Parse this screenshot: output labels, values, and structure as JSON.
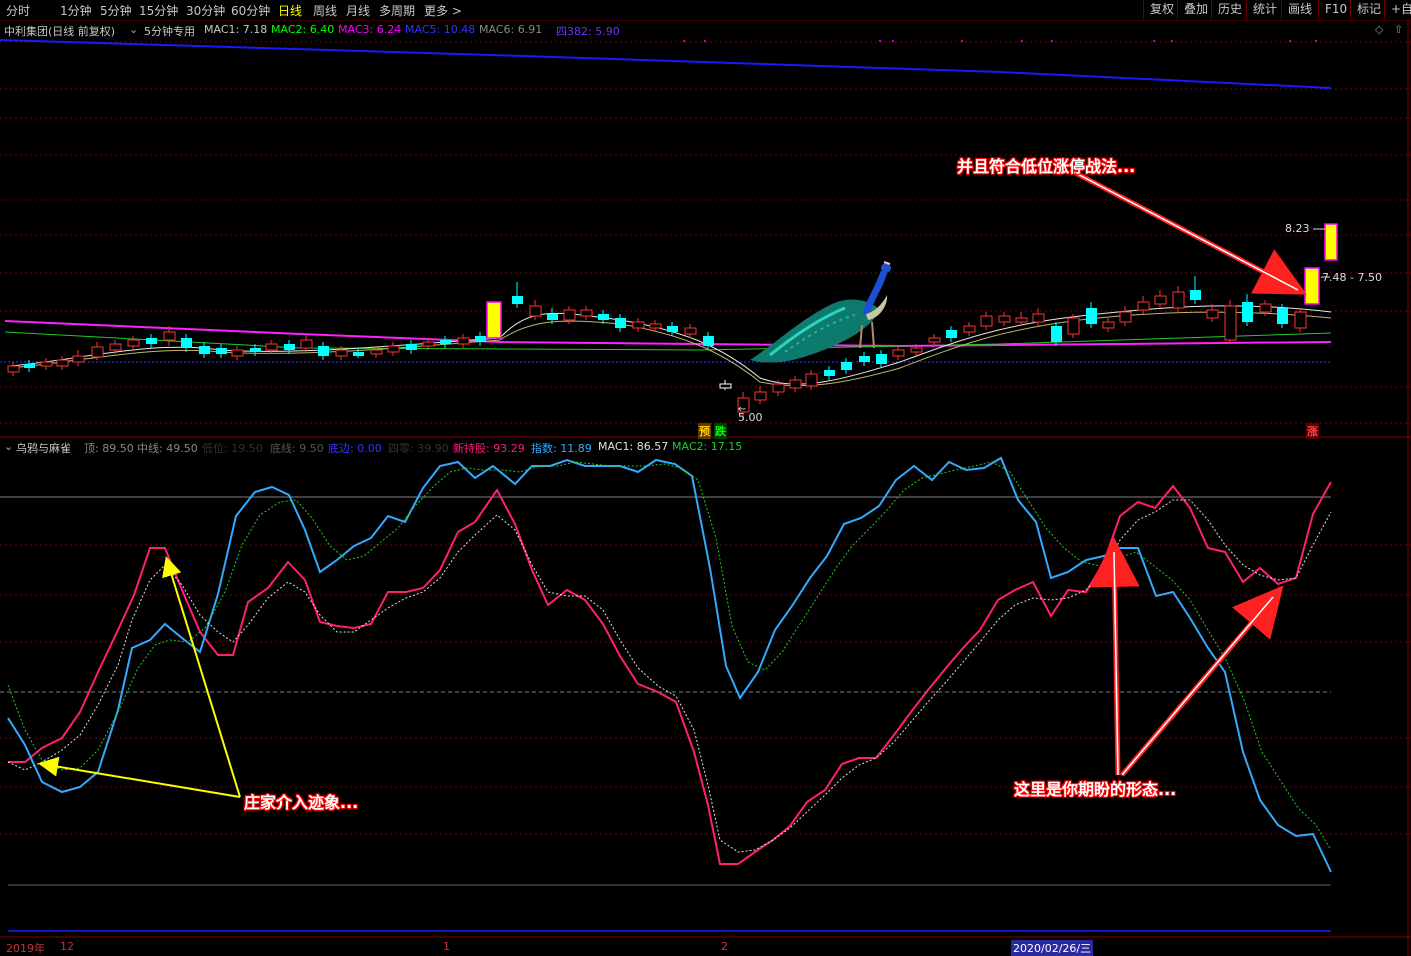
{
  "toolbar": {
    "tabs": [
      "分时",
      "1分钟",
      "5分钟",
      "15分钟",
      "30分钟",
      "60分钟",
      "日线",
      "周线",
      "月线",
      "多周期",
      "更多 >"
    ],
    "active_tab": "日线",
    "right_buttons": [
      "复权",
      "叠加",
      "历史",
      "统计",
      "画线",
      "F10",
      "标记",
      "+自"
    ]
  },
  "main_info": {
    "stock": "中利集团(日线 前复权)",
    "indicator": "5分钟专用",
    "mac1": "MAC1: 7.18",
    "mac2": "MAC2: 6.40",
    "mac3": "MAC3: 6.24",
    "mac5": "MAC5: 10.48",
    "mac6": "MAC6: 6.91",
    "four382": "四382: 5.90"
  },
  "price_labels": {
    "high": "8.23",
    "range": "7.48 - 7.50",
    "low": "5.00"
  },
  "signals": {
    "yu": "预",
    "die": "跌",
    "zhang": "涨"
  },
  "sub_info": {
    "name": "乌鸦与麻雀",
    "top": "顶: 89.50",
    "mid": "中线: 49.50",
    "low": "低位: 19.50",
    "bottom": "底线: 9.50",
    "edge": "底边: 0.00",
    "four": "四零: 39.90",
    "new": "新持股: 93.29",
    "index": "指数: 11.89",
    "mac1": "MAC1: 86.57",
    "mac2": "MAC2: 17.15"
  },
  "annotations": {
    "top_right": "并且符合低位涨停战法...",
    "left": "庄家介入迹象...",
    "right": "这里是你期盼的形态..."
  },
  "dates": {
    "year": "2019年",
    "m12": "12",
    "m1": "1",
    "m2": "2",
    "cursor": "2020/02/26/三"
  },
  "colors": {
    "up": "#ff3232",
    "down": "#00ffff",
    "magenta": "#ff00ff",
    "blue": "#0000ff",
    "pink": "#ff1493",
    "sky": "#33aaff"
  }
}
